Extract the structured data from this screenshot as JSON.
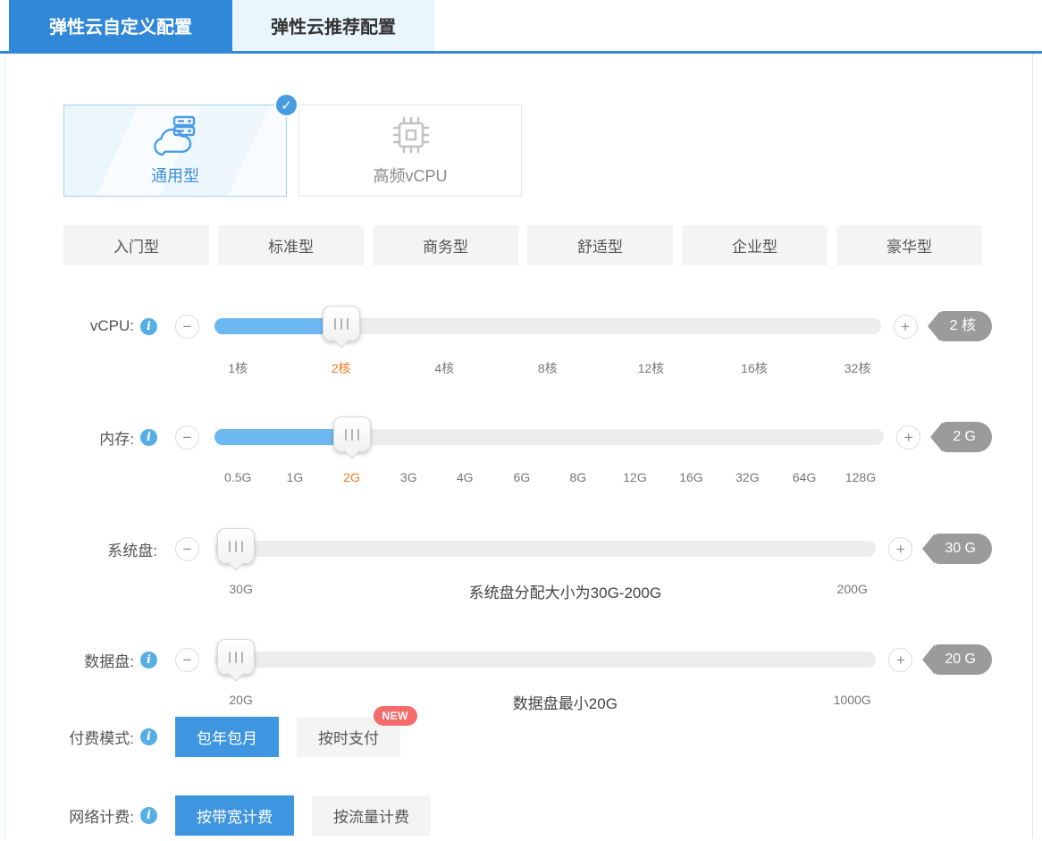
{
  "tabs": [
    {
      "label": "弹性云自定义配置",
      "active": true
    },
    {
      "label": "弹性云推荐配置",
      "active": false
    }
  ],
  "instance_types": [
    {
      "label": "通用型",
      "icon": "cloud-server-icon",
      "selected": true
    },
    {
      "label": "高频vCPU",
      "icon": "cpu-chip-icon",
      "selected": false
    }
  ],
  "presets": [
    "入门型",
    "标准型",
    "商务型",
    "舒适型",
    "企业型",
    "豪华型"
  ],
  "sliders": {
    "vcpu": {
      "label": "vCPU:",
      "ticks": [
        "1核",
        "2核",
        "4核",
        "8核",
        "12核",
        "16核",
        "32核"
      ],
      "selected_tick": "2核",
      "value_badge": "2 核"
    },
    "memory": {
      "label": "内存:",
      "ticks": [
        "0.5G",
        "1G",
        "2G",
        "3G",
        "4G",
        "6G",
        "8G",
        "12G",
        "16G",
        "32G",
        "64G",
        "128G"
      ],
      "selected_tick": "2G",
      "value_badge": "2 G"
    },
    "system_disk": {
      "label": "系统盘:",
      "min_label": "30G",
      "hint": "系统盘分配大小为30G-200G",
      "max_label": "200G",
      "value_badge": "30 G"
    },
    "data_disk": {
      "label": "数据盘:",
      "min_label": "20G",
      "hint": "数据盘最小20G",
      "max_label": "1000G",
      "value_badge": "20 G"
    }
  },
  "payment_mode": {
    "label": "付费模式:",
    "options": [
      {
        "label": "包年包月",
        "selected": true
      },
      {
        "label": "按时支付",
        "selected": false,
        "badge": "NEW"
      }
    ]
  },
  "network_billing": {
    "label": "网络计费:",
    "options": [
      {
        "label": "按带宽计费",
        "selected": true
      },
      {
        "label": "按流量计费",
        "selected": false
      }
    ]
  },
  "icons": {
    "minus": "−",
    "plus": "+",
    "info": "i",
    "check": "✓"
  },
  "colors": {
    "primary_blue": "#3288d8",
    "button_blue": "#3e95e0",
    "slider_fill_blue": "#6cb9f2",
    "selected_tick_orange": "#f57a1c",
    "value_badge_gray": "#9b9b9b",
    "new_badge_red": "#f56c6c"
  }
}
